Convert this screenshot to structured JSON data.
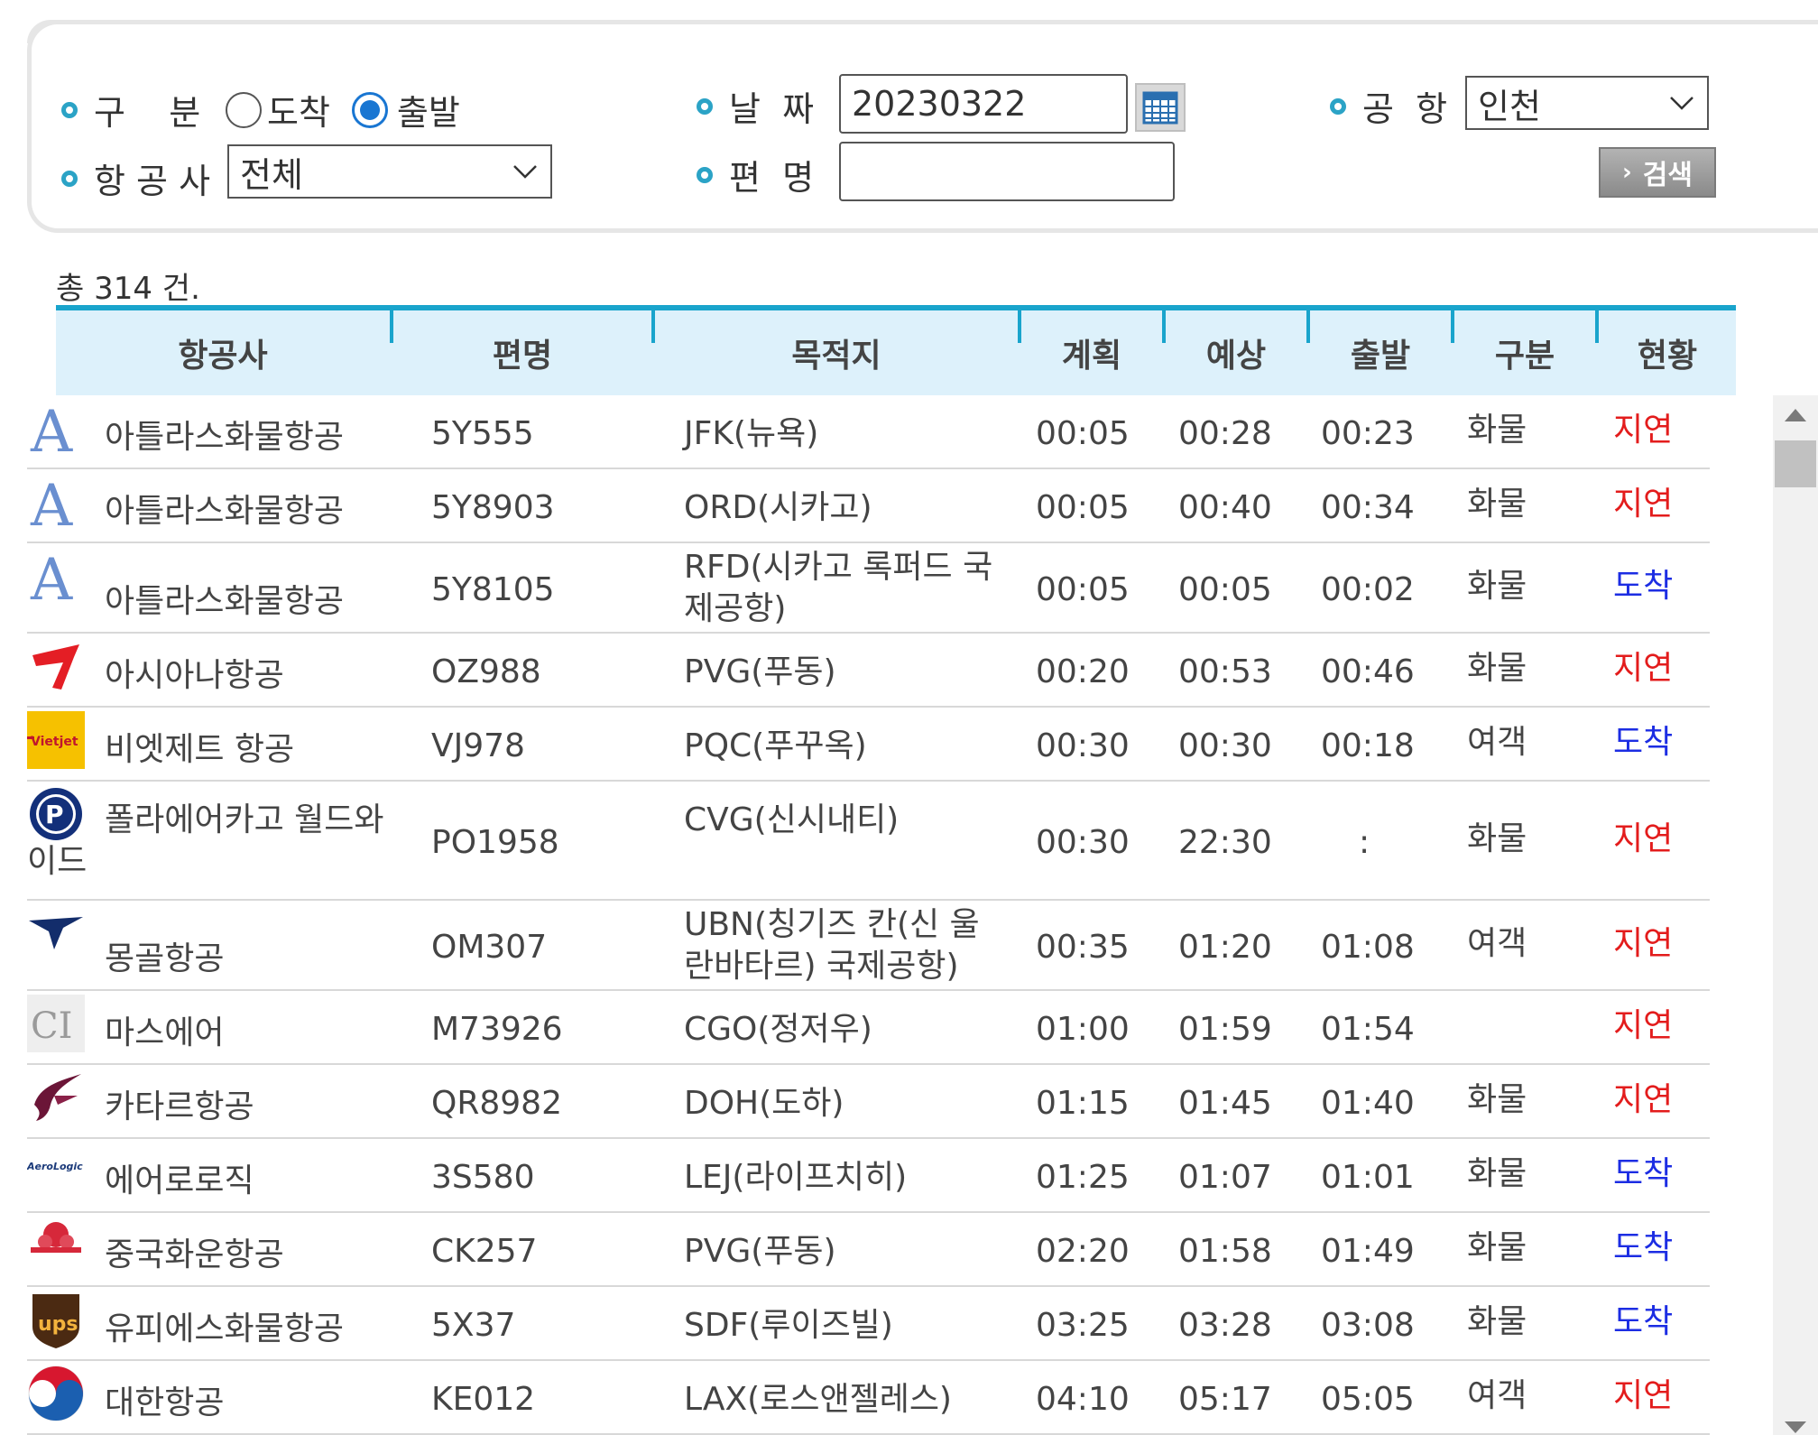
{
  "search": {
    "type_label": "구    분",
    "arrival_label": "도착",
    "departure_label": "출발",
    "date_label": "날  짜",
    "date_value": "20230322",
    "airport_label": "공  항",
    "airport_value": "인천",
    "airline_label": "항 공 사",
    "airline_value": "전체",
    "flight_label": "편  명",
    "flight_value": "",
    "search_button": "검색",
    "accent_color": "#2ba3c6"
  },
  "summary": {
    "total_text": "총 314 건."
  },
  "table": {
    "headers": [
      "항공사",
      "편명",
      "목적지",
      "계획",
      "예상",
      "출발",
      "구분",
      "현황"
    ],
    "rows": [
      {
        "logo": "atlas-air-logo-icon",
        "airline": "아틀라스화물항공",
        "flight": "5Y555",
        "dest": "JFK(뉴욕)",
        "plan": "00:05",
        "est": "00:28",
        "dep": "00:23",
        "type": "화물",
        "status": "지연",
        "status_color": "#e31c1c"
      },
      {
        "logo": "atlas-air-logo-icon",
        "airline": "아틀라스화물항공",
        "flight": "5Y8903",
        "dest": "ORD(시카고)",
        "plan": "00:05",
        "est": "00:40",
        "dep": "00:34",
        "type": "화물",
        "status": "지연",
        "status_color": "#e31c1c"
      },
      {
        "logo": "atlas-air-logo-icon",
        "airline": "아틀라스화물항공",
        "flight": "5Y8105",
        "dest": "RFD(시카고 록퍼드 국제공항)",
        "plan": "00:05",
        "est": "00:05",
        "dep": "00:02",
        "type": "화물",
        "status": "도착",
        "status_color": "#1c2de3"
      },
      {
        "logo": "asiana-logo-icon",
        "airline": "아시아나항공",
        "flight": "OZ988",
        "dest": "PVG(푸동)",
        "plan": "00:20",
        "est": "00:53",
        "dep": "00:46",
        "type": "화물",
        "status": "지연",
        "status_color": "#e31c1c"
      },
      {
        "logo": "vietjet-logo-icon",
        "airline": "비엣제트 항공",
        "flight": "VJ978",
        "dest": "PQC(푸꾸옥)",
        "plan": "00:30",
        "est": "00:30",
        "dep": "00:18",
        "type": "여객",
        "status": "도착",
        "status_color": "#1c2de3"
      },
      {
        "logo": "polar-air-logo-icon",
        "airline": "폴라에어카고 월드와이드",
        "flight": "PO1958",
        "dest": "CVG(신시내티)",
        "plan": "00:30",
        "est": "22:30",
        "dep": ":",
        "type": "화물",
        "status": "지연",
        "status_color": "#e31c1c"
      },
      {
        "logo": "mongolian-airlines-logo-icon",
        "airline": "몽골항공",
        "flight": "OM307",
        "dest": "UBN(칭기즈 칸(신 울란바타르) 국제공항)",
        "plan": "00:35",
        "est": "01:20",
        "dep": "01:08",
        "type": "여객",
        "status": "지연",
        "status_color": "#e31c1c"
      },
      {
        "logo": "mas-air-logo-icon",
        "airline": "마스에어",
        "flight": "M73926",
        "dest": "CGO(정저우)",
        "plan": "01:00",
        "est": "01:59",
        "dep": "01:54",
        "type": "",
        "status": "지연",
        "status_color": "#e31c1c"
      },
      {
        "logo": "qatar-airways-logo-icon",
        "airline": "카타르항공",
        "flight": "QR8982",
        "dest": "DOH(도하)",
        "plan": "01:15",
        "est": "01:45",
        "dep": "01:40",
        "type": "화물",
        "status": "지연",
        "status_color": "#e31c1c"
      },
      {
        "logo": "aerologic-logo-icon",
        "airline": "에어로로직",
        "flight": "3S580",
        "dest": "LEJ(라이프치히)",
        "plan": "01:25",
        "est": "01:07",
        "dep": "01:01",
        "type": "화물",
        "status": "도착",
        "status_color": "#1c2de3"
      },
      {
        "logo": "china-cargo-logo-icon",
        "airline": "중국화운항공",
        "flight": "CK257",
        "dest": "PVG(푸동)",
        "plan": "02:20",
        "est": "01:58",
        "dep": "01:49",
        "type": "화물",
        "status": "도착",
        "status_color": "#1c2de3"
      },
      {
        "logo": "ups-logo-icon",
        "airline": "유피에스화물항공",
        "flight": "5X37",
        "dest": "SDF(루이즈빌)",
        "plan": "03:25",
        "est": "03:28",
        "dep": "03:08",
        "type": "화물",
        "status": "도착",
        "status_color": "#1c2de3"
      },
      {
        "logo": "korean-air-logo-icon",
        "airline": "대한항공",
        "flight": "KE012",
        "dest": "LAX(로스앤젤레스)",
        "plan": "04:10",
        "est": "05:17",
        "dep": "05:05",
        "type": "여객",
        "status": "지연",
        "status_color": "#e31c1c"
      }
    ]
  }
}
